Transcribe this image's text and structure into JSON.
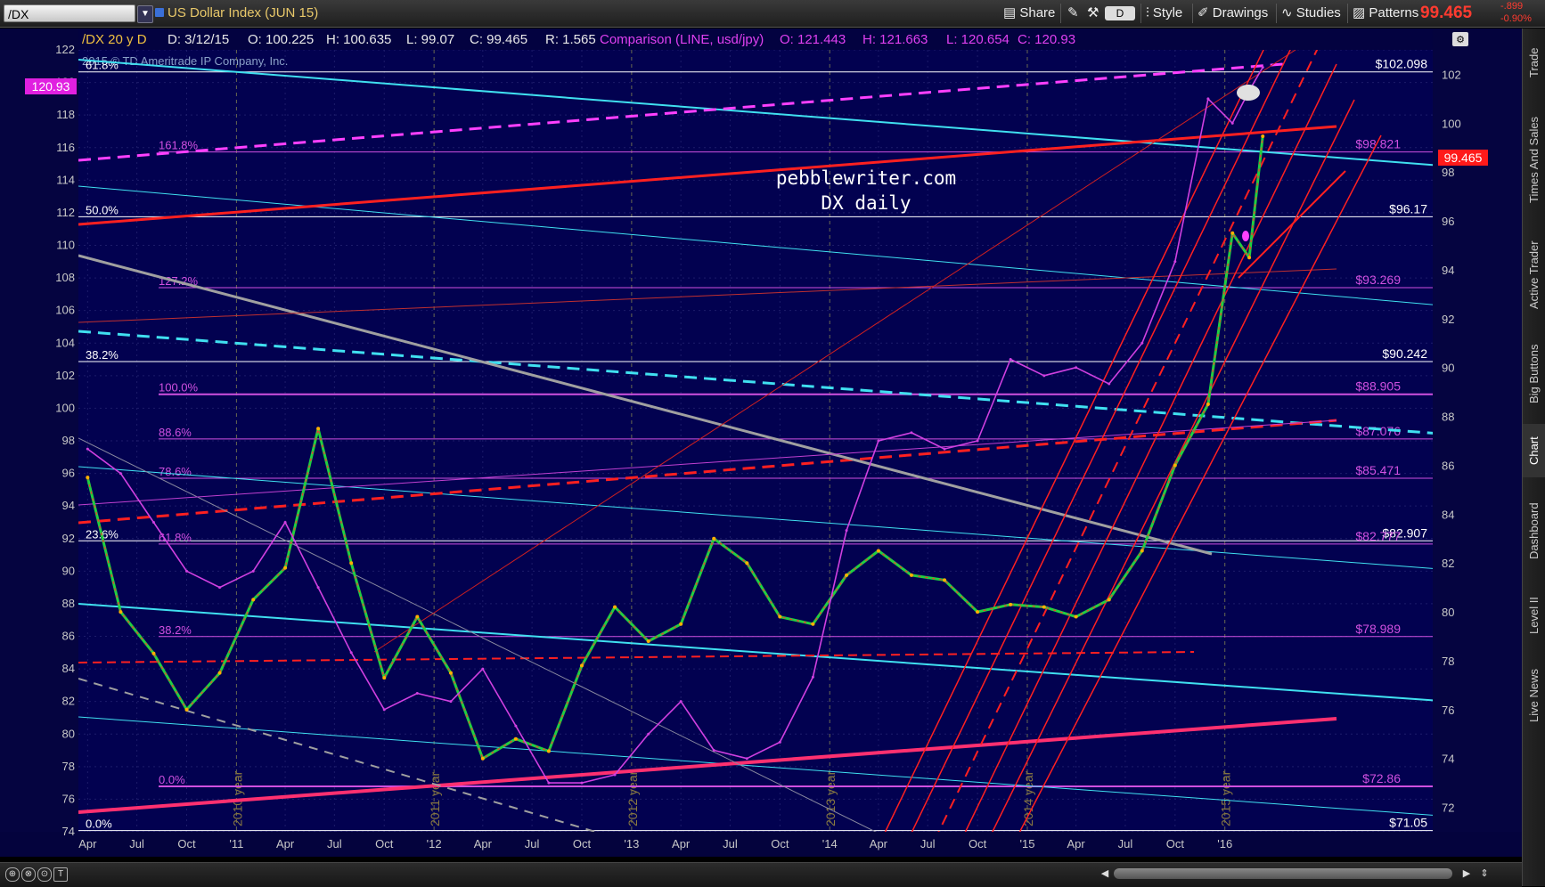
{
  "topbar": {
    "symbol": "/DX",
    "title": "US Dollar Index (JUN 15)",
    "buttons": {
      "share": "Share",
      "style": "Style",
      "drawings": "Drawings",
      "studies": "Studies",
      "patterns": "Patterns",
      "d_badge": "D"
    },
    "last_price": "99.465",
    "change_abs": "-.899",
    "change_pct": "-0.90%"
  },
  "info_strip": {
    "series": "/DX 20 y D",
    "date": "D: 3/12/15",
    "open": "O: 100.225",
    "high": "H: 100.635",
    "low": "L: 99.07",
    "close": "C: 99.465",
    "range": "R: 1.565",
    "comparison": "Comparison (LINE, usd/jpy)",
    "cmp_open": "O: 121.443",
    "cmp_high": "H: 121.663",
    "cmp_low": "L: 120.654",
    "cmp_close": "C: 120.93"
  },
  "copyright": "2015 © TD Ameritrade IP Company, Inc.",
  "watermark": {
    "line1": "pebblewriter.com",
    "line2": "DX daily"
  },
  "right_tabs": [
    "Trade",
    "Times And Sales",
    "Active Trader",
    "Big Buttons",
    "Chart",
    "Dashboard",
    "Level II",
    "Live News"
  ],
  "bottom_icons": [
    "zoom-in",
    "crosshair",
    "drawing",
    "text"
  ],
  "colors": {
    "background": "#020150",
    "fib_white": "#ffffff",
    "fib_magenta": "#d050e0",
    "cyan_line": "#40e0f0",
    "red_line": "#ff2020",
    "gray_line": "#a0a0a0",
    "comparison_line": "#d040e0",
    "candle_up": "#20d040",
    "candle_down": "#ff3030"
  },
  "chart_data": {
    "type": "line",
    "title": "US Dollar Index (JUN 15)",
    "series": [
      {
        "name": "/DX",
        "axis": "right",
        "x": [
          "2009-04-01",
          "2009-06-01",
          "2009-08-01",
          "2009-10-01",
          "2009-12-01",
          "2010-02-01",
          "2010-04-01",
          "2010-06-01",
          "2010-08-01",
          "2010-10-01",
          "2010-12-01",
          "2011-02-01",
          "2011-04-01",
          "2011-06-01",
          "2011-08-01",
          "2011-10-01",
          "2011-12-01",
          "2012-02-01",
          "2012-04-01",
          "2012-06-01",
          "2012-08-01",
          "2012-10-01",
          "2012-12-01",
          "2013-02-01",
          "2013-04-01",
          "2013-06-01",
          "2013-08-01",
          "2013-10-01",
          "2013-12-01",
          "2014-02-01",
          "2014-04-01",
          "2014-06-01",
          "2014-08-01",
          "2014-10-01",
          "2014-12-01",
          "2015-01-15",
          "2015-02-15",
          "2015-03-12"
        ],
        "values": [
          85.5,
          80.0,
          78.3,
          76.0,
          77.5,
          80.5,
          81.8,
          87.5,
          82.0,
          77.3,
          79.8,
          77.5,
          74.0,
          74.8,
          74.3,
          77.8,
          80.2,
          78.8,
          79.5,
          83.0,
          82.0,
          79.8,
          79.5,
          81.5,
          82.5,
          81.5,
          81.3,
          80.0,
          80.3,
          80.2,
          79.8,
          80.5,
          82.5,
          86.0,
          88.5,
          95.5,
          94.5,
          99.465
        ]
      },
      {
        "name": "Comparison (LINE, usd/jpy)",
        "axis": "left",
        "x": [
          "2009-04-01",
          "2009-06-01",
          "2009-08-01",
          "2009-10-01",
          "2009-12-01",
          "2010-02-01",
          "2010-04-01",
          "2010-06-01",
          "2010-08-01",
          "2010-10-01",
          "2010-12-01",
          "2011-02-01",
          "2011-04-01",
          "2011-06-01",
          "2011-08-01",
          "2011-10-01",
          "2011-12-01",
          "2012-02-01",
          "2012-04-01",
          "2012-06-01",
          "2012-08-01",
          "2012-10-01",
          "2012-12-01",
          "2013-02-01",
          "2013-04-01",
          "2013-06-01",
          "2013-08-01",
          "2013-10-01",
          "2013-12-01",
          "2014-02-01",
          "2014-04-01",
          "2014-06-01",
          "2014-08-01",
          "2014-10-01",
          "2014-12-01",
          "2015-01-15",
          "2015-02-15",
          "2015-03-12"
        ],
        "values": [
          97.5,
          96.0,
          93.0,
          90.0,
          89.0,
          90.0,
          93.0,
          89.0,
          85.0,
          81.5,
          82.5,
          82.0,
          84.0,
          80.5,
          77.0,
          77.0,
          77.5,
          80.0,
          82.0,
          79.0,
          78.5,
          79.5,
          83.5,
          92.5,
          98.0,
          98.5,
          97.5,
          98.0,
          103.0,
          102.0,
          102.5,
          101.5,
          104.0,
          109.0,
          119.0,
          117.5,
          119.5,
          120.93
        ]
      }
    ],
    "x_tick_labels": [
      "Apr",
      "Jul",
      "Oct",
      "'11",
      "Apr",
      "Jul",
      "Oct",
      "'12",
      "Apr",
      "Jul",
      "Oct",
      "'13",
      "Apr",
      "Jul",
      "Oct",
      "'14",
      "Apr",
      "Jul",
      "Oct",
      "'15",
      "Apr",
      "Jul",
      "Oct",
      "'16"
    ],
    "year_markers": [
      "2010 year",
      "2011 year",
      "2012 year",
      "2013 year",
      "2014 year",
      "2015 year"
    ],
    "y_left": {
      "min": 74,
      "max": 122,
      "step": 2
    },
    "y_right": {
      "min": 71,
      "max": 103,
      "step": 2,
      "labels": [
        72,
        74,
        76,
        78,
        80,
        82,
        84,
        86,
        88,
        90,
        92,
        94,
        96,
        98,
        100,
        102
      ]
    },
    "fib_levels_white": [
      {
        "pct": "61.8%",
        "price": "$102.098"
      },
      {
        "pct": "50.0%",
        "price": "$96.17"
      },
      {
        "pct": "38.2%",
        "price": "$90.242"
      },
      {
        "pct": "23.6%",
        "price": "$82.907"
      },
      {
        "pct": "0.0%",
        "price": "$71.05"
      }
    ],
    "fib_levels_magenta": [
      {
        "pct": "161.8%",
        "price": "$98.821"
      },
      {
        "pct": "127.2%",
        "price": "$93.269"
      },
      {
        "pct": "100.0%",
        "price": "$88.905"
      },
      {
        "pct": "88.6%",
        "price": "$87.076"
      },
      {
        "pct": "78.6%",
        "price": "$85.471"
      },
      {
        "pct": "61.8%",
        "price": "$82.777"
      },
      {
        "pct": "38.2%",
        "price": "$78.989"
      },
      {
        "pct": "0.0%",
        "price": "$72.86"
      }
    ],
    "price_badges": {
      "left": "120.93",
      "right": "99.465"
    },
    "grid": true
  }
}
